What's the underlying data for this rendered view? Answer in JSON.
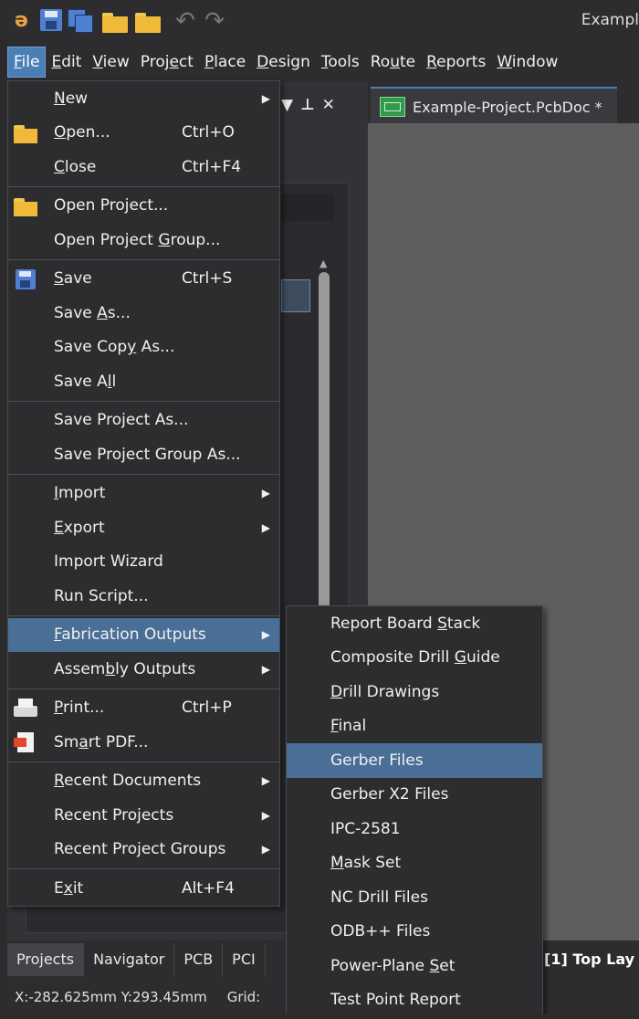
{
  "window": {
    "title": "Exampl"
  },
  "menubar": [
    {
      "pre": "",
      "acc": "F",
      "post": "ile",
      "active": true
    },
    {
      "pre": "",
      "acc": "E",
      "post": "dit"
    },
    {
      "pre": "",
      "acc": "V",
      "post": "iew"
    },
    {
      "pre": "Proj",
      "acc": "e",
      "post": "ct"
    },
    {
      "pre": "",
      "acc": "P",
      "post": "lace"
    },
    {
      "pre": "",
      "acc": "D",
      "post": "esign"
    },
    {
      "pre": "",
      "acc": "T",
      "post": "ools"
    },
    {
      "pre": "Ro",
      "acc": "u",
      "post": "te"
    },
    {
      "pre": "",
      "acc": "R",
      "post": "eports"
    },
    {
      "pre": "",
      "acc": "W",
      "post": "indow"
    }
  ],
  "doc_tab": {
    "label": "Example-Project.PcbDoc *"
  },
  "panel": {
    "pin_icon": "pin-icon",
    "close_icon": "close-icon",
    "dropdown_icon": "triangle-down-icon"
  },
  "file_menu": [
    {
      "pre": "",
      "acc": "N",
      "post": "ew",
      "sub": true
    },
    {
      "icon": "folder",
      "pre": "",
      "acc": "O",
      "post": "pen...",
      "shortcut": "Ctrl+O"
    },
    {
      "pre": "",
      "acc": "C",
      "post": "lose",
      "shortcut": "Ctrl+F4"
    },
    {
      "sep": true
    },
    {
      "icon": "folder",
      "pre": "Open Pro",
      "acc": "j",
      "post": "ect..."
    },
    {
      "pre": "Open Project ",
      "acc": "G",
      "post": "roup..."
    },
    {
      "sep": true
    },
    {
      "icon": "floppy",
      "pre": "",
      "acc": "S",
      "post": "ave",
      "shortcut": "Ctrl+S"
    },
    {
      "pre": "Save ",
      "acc": "A",
      "post": "s..."
    },
    {
      "pre": "Save Cop",
      "acc": "y",
      "post": " As..."
    },
    {
      "pre": "Save A",
      "acc": "l",
      "post": "l"
    },
    {
      "sep": true
    },
    {
      "pre": "Save Project As...",
      "acc": "",
      "post": ""
    },
    {
      "pre": "Save Project Group As...",
      "acc": "",
      "post": ""
    },
    {
      "sep": true
    },
    {
      "pre": "",
      "acc": "I",
      "post": "mport",
      "sub": true
    },
    {
      "pre": "",
      "acc": "E",
      "post": "xport",
      "sub": true
    },
    {
      "pre": "Import Wizard",
      "acc": "",
      "post": ""
    },
    {
      "pre": "Run Script...",
      "acc": "",
      "post": ""
    },
    {
      "sep": true
    },
    {
      "pre": "",
      "acc": "F",
      "post": "abrication Outputs",
      "sub": true,
      "active": true
    },
    {
      "pre": "Assem",
      "acc": "b",
      "post": "ly Outputs",
      "sub": true
    },
    {
      "sep": true
    },
    {
      "icon": "printer",
      "pre": "",
      "acc": "P",
      "post": "rint...",
      "shortcut": "Ctrl+P"
    },
    {
      "icon": "pdf",
      "pre": "Sm",
      "acc": "a",
      "post": "rt PDF..."
    },
    {
      "sep": true
    },
    {
      "pre": "",
      "acc": "R",
      "post": "ecent Documents",
      "sub": true
    },
    {
      "pre": "Recent Projects",
      "acc": "",
      "post": "",
      "sub": true
    },
    {
      "pre": "Recent Project Groups",
      "acc": "",
      "post": "",
      "sub": true
    },
    {
      "sep": true
    },
    {
      "pre": "E",
      "acc": "x",
      "post": "it",
      "shortcut": "Alt+F4"
    }
  ],
  "fab_submenu": [
    {
      "pre": "Report Board ",
      "acc": "S",
      "post": "tack"
    },
    {
      "pre": "Composite Drill ",
      "acc": "G",
      "post": "uide"
    },
    {
      "pre": "",
      "acc": "D",
      "post": "rill Drawings"
    },
    {
      "pre": "",
      "acc": "F",
      "post": "inal"
    },
    {
      "pre": "Gerber Files",
      "acc": "",
      "post": "",
      "active": true
    },
    {
      "pre": "Gerber X2 Files",
      "acc": "",
      "post": ""
    },
    {
      "pre": "IPC-2581",
      "acc": "",
      "post": ""
    },
    {
      "pre": "",
      "acc": "M",
      "post": "ask Set"
    },
    {
      "pre": "NC Drill Files",
      "acc": "",
      "post": ""
    },
    {
      "pre": "ODB++ Files",
      "acc": "",
      "post": ""
    },
    {
      "pre": "Power-Plane ",
      "acc": "S",
      "post": "et"
    },
    {
      "pre": "Test Point Report",
      "acc": "",
      "post": ""
    }
  ],
  "bottom_tabs": [
    "Projects",
    "Navigator",
    "PCB",
    "PCI"
  ],
  "layer_tab": "[1] Top Lay",
  "status": {
    "coords": "X:-282.625mm Y:293.45mm",
    "grid": "Grid:"
  }
}
